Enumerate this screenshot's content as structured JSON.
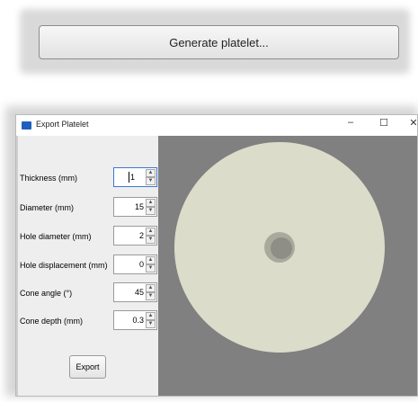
{
  "top": {
    "generate_label": "Generate platelet..."
  },
  "dialog": {
    "title": "Export Platelet",
    "controls": {
      "minimize": "–",
      "maximize": "☐",
      "close": "✕"
    },
    "fields": [
      {
        "label": "Thickness (mm)",
        "value": "1"
      },
      {
        "label": "Diameter (mm)",
        "value": "15"
      },
      {
        "label": "Hole diameter (mm)",
        "value": "2"
      },
      {
        "label": "Hole displacement (mm)",
        "value": "0"
      },
      {
        "label": "Cone angle (°)",
        "value": "45"
      },
      {
        "label": "Cone depth (mm)",
        "value": "0.3"
      }
    ],
    "export_label": "Export",
    "colors": {
      "disc": "#dcdccb",
      "hole": "#8e8e86",
      "canvas": "#808080",
      "accent": "#3d76d6"
    }
  }
}
